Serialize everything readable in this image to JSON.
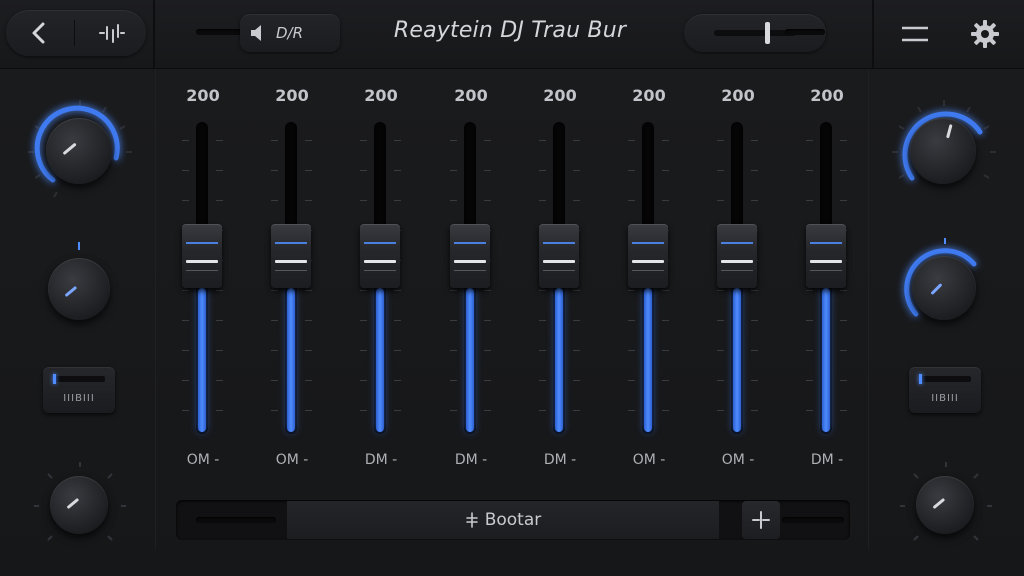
{
  "header": {
    "title": "Reaytein DJ Trau Bur",
    "audio_label": "D/R",
    "icons": {
      "back": "chevron-left-icon",
      "eq": "equalizer-icon",
      "speaker": "speaker-icon",
      "menu": "hamburger-menu-icon",
      "settings": "gear-icon"
    }
  },
  "faders": [
    {
      "value": "200",
      "label": "OM -",
      "level": 0.39
    },
    {
      "value": "200",
      "label": "OM -",
      "level": 0.39
    },
    {
      "value": "200",
      "label": "DM -",
      "level": 0.39
    },
    {
      "value": "200",
      "label": "DM -",
      "level": 0.39
    },
    {
      "value": "200",
      "label": "DM -",
      "level": 0.39
    },
    {
      "value": "200",
      "label": "OM -",
      "level": 0.39
    },
    {
      "value": "200",
      "label": "OM -",
      "level": 0.39
    },
    {
      "value": "200",
      "label": "DM -",
      "level": 0.39
    }
  ],
  "left_panel": {
    "button_label": "IIIBIII"
  },
  "right_panel": {
    "button_label": "IIBIII"
  },
  "footer": {
    "button_label": "Bootar",
    "button_icon": "sparkle-icon",
    "plus_icon": "plus-icon"
  },
  "colors": {
    "accent": "#4f8cff",
    "background": "#141416"
  }
}
